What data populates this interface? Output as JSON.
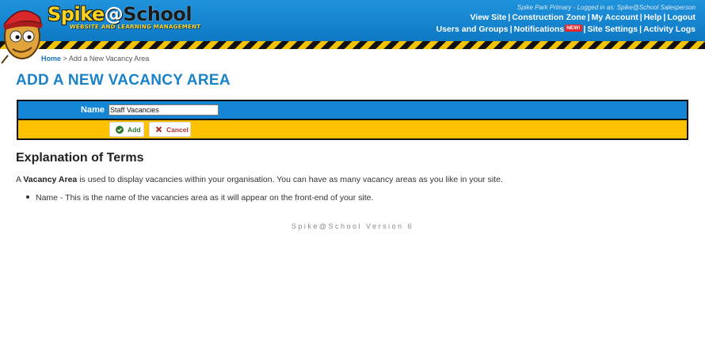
{
  "header": {
    "logo_spike": "Spike",
    "logo_at": "@",
    "logo_school": "School",
    "logo_subtitle": "WEBSITE AND LEARNING MANAGEMENT",
    "logged_in": "Spike Park Primary - Logged in as: Spike@School Salesperson",
    "nav_row1": [
      "View Site",
      "Construction Zone",
      "My Account",
      "Help",
      "Logout"
    ],
    "nav_row2": {
      "users_groups": "Users and Groups",
      "notifications": "Notifications",
      "new_badge": "NEW!",
      "site_settings": "Site Settings",
      "activity_logs": "Activity Logs"
    }
  },
  "breadcrumb": {
    "home": "Home",
    "separator": ">",
    "current": "Add a New Vacancy Area"
  },
  "page_title": "ADD A NEW VACANCY AREA",
  "form": {
    "name_label": "Name",
    "name_value": "Staff Vacancies",
    "add_label": "Add",
    "cancel_label": "Cancel"
  },
  "explanation": {
    "title": "Explanation of Terms",
    "intro_prefix": "A",
    "intro_term": "Vacancy Area",
    "intro_rest": "is used to display vacancies within your organisation. You can have as many vacancy areas as you like in your site.",
    "items": [
      "Name - This is the name of the vacancies area as it will appear on the front-end of your site."
    ]
  },
  "version": "Spike@School Version 6",
  "colors": {
    "header_blue": "#1585d6",
    "title_blue": "#1a82c9",
    "form_yellow": "#fcc200",
    "hazard_yellow": "#f2c200",
    "add_green": "#2a7a2a",
    "cancel_red": "#b83030",
    "badge_red": "#e8262c"
  },
  "icons": {
    "mascot": "mascot-icon",
    "add": "check-circle-icon",
    "cancel": "cross-icon"
  }
}
